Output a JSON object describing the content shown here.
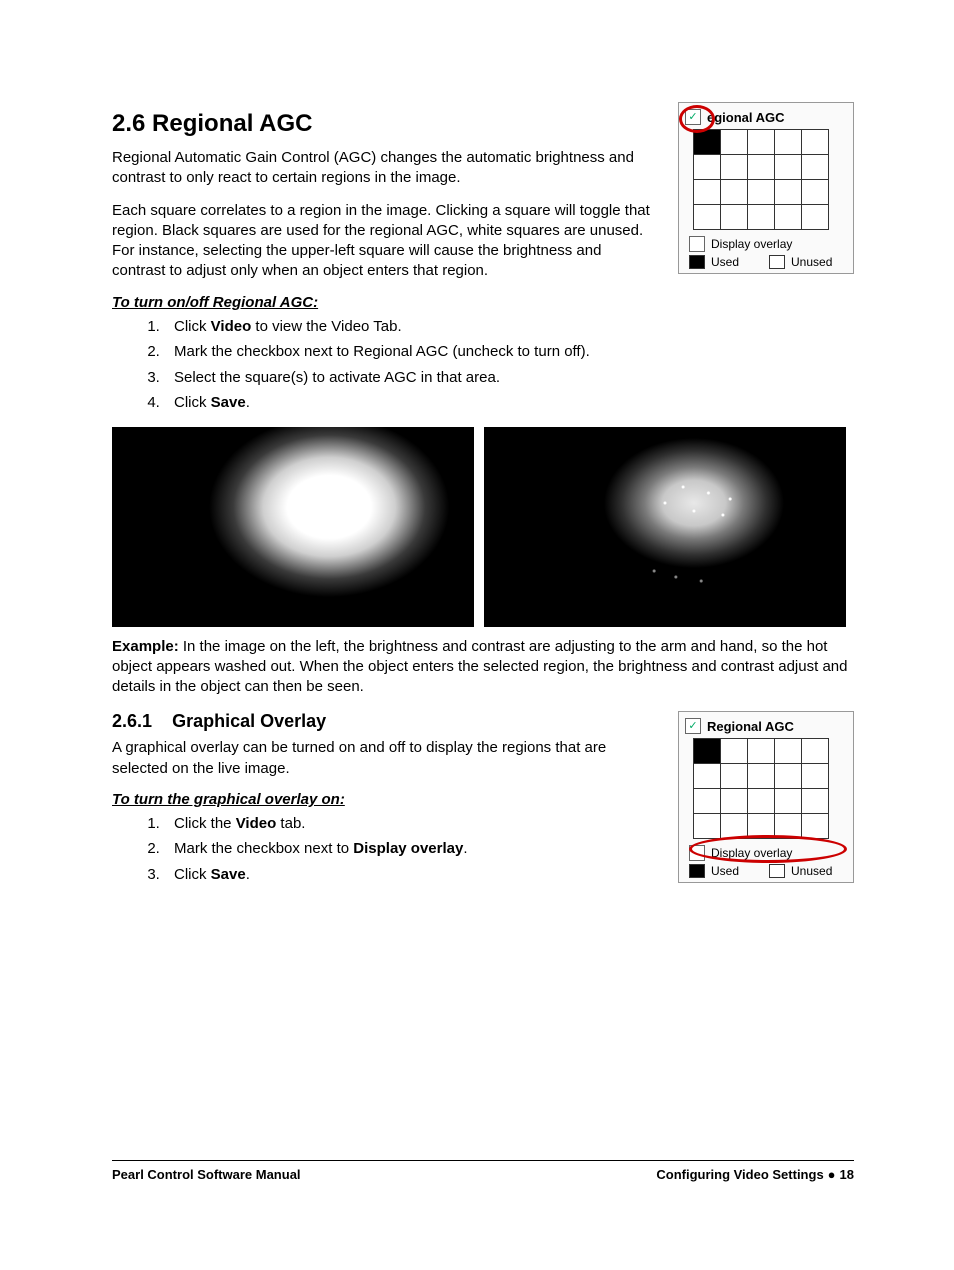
{
  "section": {
    "number": "2.6",
    "title": "Regional AGC",
    "p1": "Regional Automatic Gain Control (AGC) changes the automatic brightness and contrast to only react to certain regions in the image.",
    "p2": "Each square correlates to a region in the image. Clicking a square will toggle that region. Black squares are used for the regional AGC, white squares are unused. For instance, selecting the upper-left square will cause the brightness and contrast to adjust only when an object enters that region.",
    "instr_title": "To turn on/off Regional AGC:",
    "steps": [
      {
        "pre": "Click ",
        "kw": "Video",
        "post": " to view the Video Tab."
      },
      {
        "pre": "Mark the checkbox next to Regional AGC (uncheck to turn off).",
        "kw": "",
        "post": ""
      },
      {
        "pre": "Select the square(s) to activate AGC in that area.",
        "kw": "",
        "post": ""
      },
      {
        "pre": "Click ",
        "kw": "Save",
        "post": "."
      }
    ],
    "example_label": "Example:",
    "example_text": " In the image on the left, the brightness and contrast are adjusting to the arm and hand, so the hot object appears washed out. When the object enters the selected region, the brightness and contrast adjust and details in the object can then be seen."
  },
  "subsection": {
    "number": "2.6.1",
    "title": "Graphical Overlay",
    "p1": "A graphical overlay can be turned on and off to display the regions that are selected on the live image.",
    "instr_title": "To turn the graphical overlay on:",
    "steps": [
      {
        "pre": "Click the ",
        "kw": "Video",
        "post": " tab."
      },
      {
        "pre": "Mark the checkbox next to ",
        "kw": "Display overlay",
        "post": "."
      },
      {
        "pre": "Click ",
        "kw": "Save",
        "post": "."
      }
    ]
  },
  "panel": {
    "title_partial": "egional AGC",
    "title_full": "Regional AGC",
    "display_overlay": "Display overlay",
    "used": "Used",
    "unused": "Unused",
    "grid_rows": 4,
    "grid_cols": 5,
    "used_cells_top": [
      [
        0,
        0
      ]
    ],
    "used_cells_bottom": [
      [
        0,
        0
      ]
    ]
  },
  "footer": {
    "left": "Pearl Control Software Manual",
    "right_section": "Configuring Video Settings",
    "page_no": "18"
  }
}
